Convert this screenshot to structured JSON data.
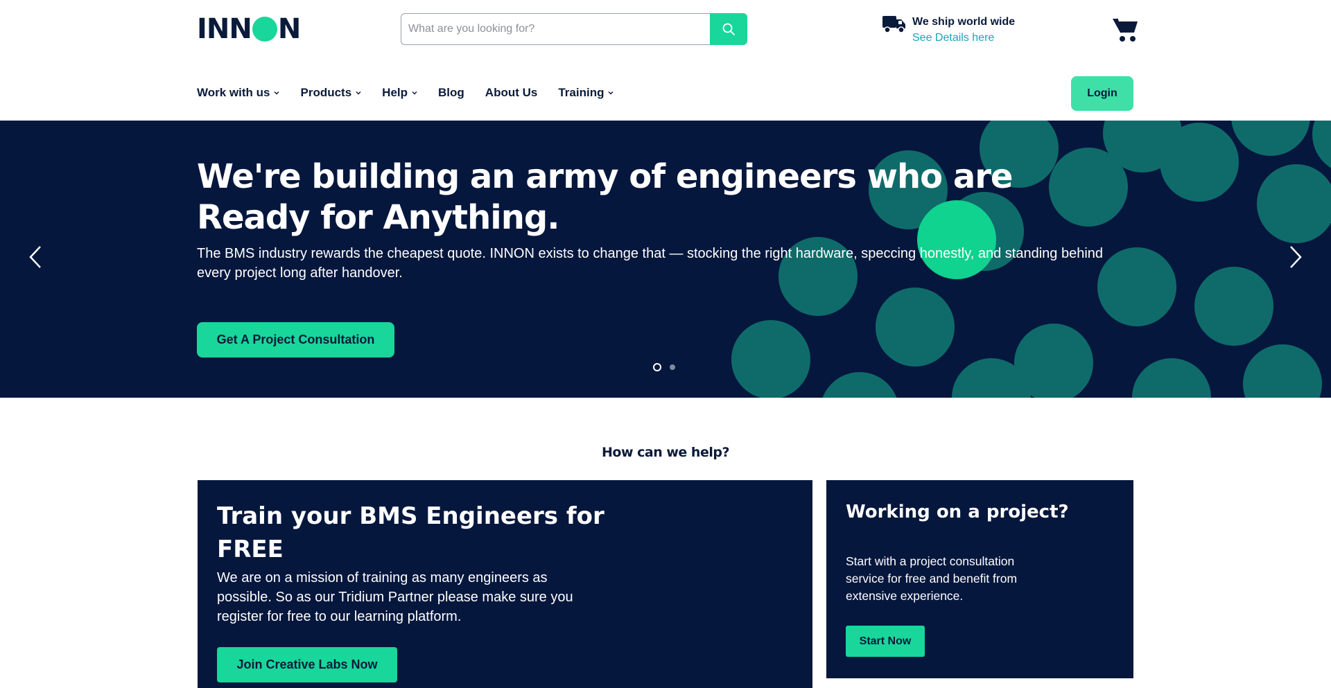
{
  "header": {
    "logo_text_left": "INN",
    "logo_text_right": "N",
    "search_placeholder": "What are you looking for?",
    "ship_title": "We ship world wide",
    "ship_link": "See Details here",
    "login_label": "Login"
  },
  "nav": {
    "items": [
      {
        "label": "Work with us",
        "dropdown": true
      },
      {
        "label": "Products",
        "dropdown": true
      },
      {
        "label": "Help",
        "dropdown": true
      },
      {
        "label": "Blog",
        "dropdown": false
      },
      {
        "label": "About Us",
        "dropdown": false
      },
      {
        "label": "Training",
        "dropdown": true
      }
    ]
  },
  "hero": {
    "title": "We're building an army of engineers who are Ready for Anything.",
    "description": "The BMS industry rewards the cheapest quote. INNON exists to change that — stocking the right hardware, speccing honestly, and standing behind every project long after handover.",
    "cta_label": "Get A Project Consultation",
    "slides_count": 2,
    "active_slide": 1
  },
  "help": {
    "title": "How can we help?"
  },
  "card_train": {
    "title": "Train your BMS Engineers for FREE",
    "description": "We are on a mission of training as many engineers as possible. So as our Tridium Partner please make sure you register for free to our learning platform.",
    "button_label": "Join Creative Labs Now"
  },
  "card_project": {
    "title": "Working on a project?",
    "description": "Start with a project consultation service for free and benefit from extensive experience.",
    "button_label": "Start Now"
  },
  "colors": {
    "accent": "#19d69a",
    "navy": "#06173d",
    "link": "#1ba4b8",
    "text": "#0a1a3a"
  },
  "icons": [
    "search-icon",
    "truck-icon",
    "cart-icon",
    "chevron-down-icon",
    "arrow-left-icon",
    "arrow-right-icon"
  ]
}
